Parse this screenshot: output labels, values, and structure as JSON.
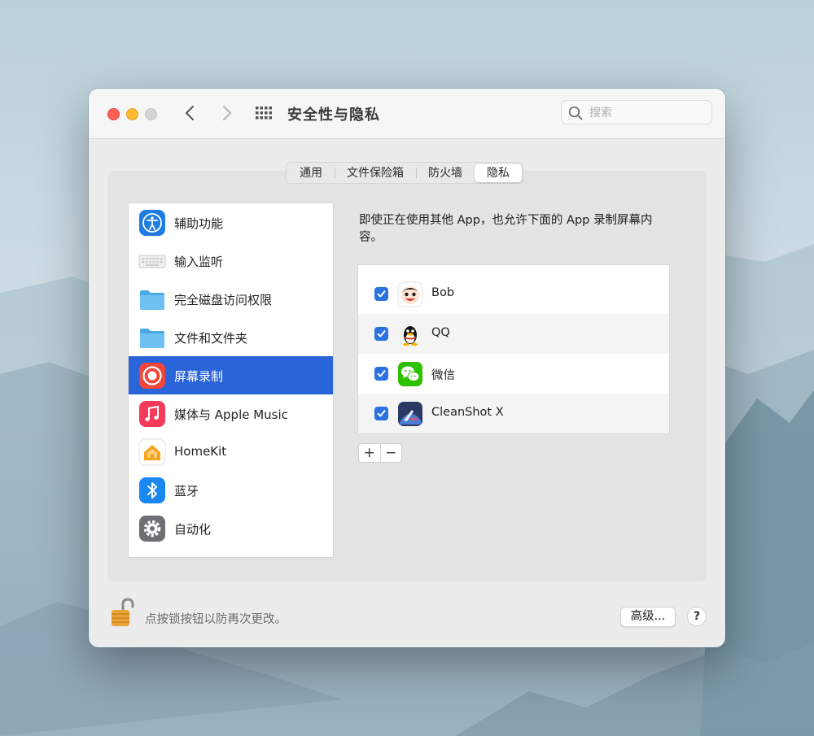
{
  "window": {
    "title": "安全性与隐私",
    "search_placeholder": "搜索"
  },
  "tabs": [
    {
      "label": "通用",
      "active": false
    },
    {
      "label": "文件保险箱",
      "active": false
    },
    {
      "label": "防火墙",
      "active": false
    },
    {
      "label": "隐私",
      "active": true
    }
  ],
  "sidebar": {
    "items": [
      {
        "label": "辅助功能",
        "icon": "accessibility-icon",
        "selected": false
      },
      {
        "label": "输入监听",
        "icon": "keyboard-icon",
        "selected": false
      },
      {
        "label": "完全磁盘访问权限",
        "icon": "folder-icon",
        "selected": false
      },
      {
        "label": "文件和文件夹",
        "icon": "folder-icon",
        "selected": false
      },
      {
        "label": "屏幕录制",
        "icon": "screen-recording-icon",
        "selected": true
      },
      {
        "label": "媒体与 Apple Music",
        "icon": "music-icon",
        "selected": false
      },
      {
        "label": "HomeKit",
        "icon": "home-icon",
        "selected": false
      },
      {
        "label": "蓝牙",
        "icon": "bluetooth-icon",
        "selected": false
      },
      {
        "label": "自动化",
        "icon": "gear-icon",
        "selected": false
      }
    ]
  },
  "detail": {
    "description": "即使正在使用其他 App，也允许下面的 App 录制屏幕内容。",
    "apps": [
      {
        "name": "Bob",
        "checked": true,
        "icon": "bob-app-icon"
      },
      {
        "name": "QQ",
        "checked": true,
        "icon": "qq-app-icon"
      },
      {
        "name": "微信",
        "checked": true,
        "icon": "wechat-app-icon"
      },
      {
        "name": "CleanShot X",
        "checked": true,
        "icon": "cleanshot-app-icon"
      }
    ],
    "add_label": "+",
    "remove_label": "−"
  },
  "footer": {
    "lock_text": "点按锁按钮以防再次更改。",
    "advanced_label": "高级...",
    "help_label": "?"
  },
  "colors": {
    "accent": "#2a64d9",
    "checkbox": "#2a72e2",
    "traffic_red": "#fe5f57",
    "traffic_yellow": "#febc2e"
  }
}
